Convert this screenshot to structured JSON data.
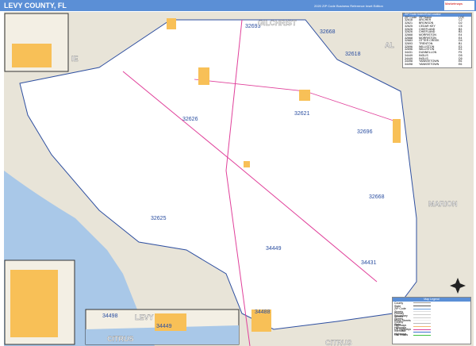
{
  "header": {
    "title": "LEVY COUNTY, FL",
    "subtitle": "2020 ZIP Code Business Reference Inset Edition",
    "logo_text": "Marketmaps"
  },
  "map": {
    "zip_labels": [
      "32693",
      "32668",
      "32618",
      "32626",
      "32621",
      "32696",
      "32668",
      "32625",
      "34449",
      "34431",
      "34498",
      "34449",
      "34488"
    ],
    "county_labels": [
      "GILCHRIST",
      "AL",
      "IE",
      "MARION",
      "LEVY",
      "CITRUS",
      "CITRUS"
    ],
    "colors": {
      "land": "#ffffff",
      "outside": "#e8e4d8",
      "water": "#a9c8e8",
      "urban": "#f8c057",
      "boundary": "#2e4fa0",
      "highway": "#e0409a"
    }
  },
  "index": {
    "title": "ZIP Code Index/Grid Locator",
    "headers": [
      "ZIP Code",
      "ZIP Name",
      "LOC"
    ],
    "rows": [
      [
        "32618",
        "ARCHER",
        "C2"
      ],
      [
        "32621",
        "BRONSON",
        "D2"
      ],
      [
        "32625",
        "CEDAR KEY",
        "C5"
      ],
      [
        "32626",
        "CHIEFLAND",
        "B3"
      ],
      [
        "32626",
        "CHIEFLAND",
        "B3"
      ],
      [
        "32668",
        "MORRISTON",
        "E4"
      ],
      [
        "32668",
        "MORRISTON",
        "E4"
      ],
      [
        "32683",
        "OTTER CREEK",
        "D4"
      ],
      [
        "32693",
        "TRENTON",
        "B1"
      ],
      [
        "32696",
        "WILLISTON",
        "E3"
      ],
      [
        "32696",
        "WILLISTON",
        "E3"
      ],
      [
        "34431",
        "DUNNELLON",
        "F5"
      ],
      [
        "34449",
        "INGLIS",
        "D5"
      ],
      [
        "34449",
        "INGLIS",
        "D5"
      ],
      [
        "34498",
        "YANKEETOWN",
        "E6"
      ],
      [
        "34498",
        "YANKEETOWN",
        "E6"
      ]
    ]
  },
  "legend": {
    "title": "Map Legend",
    "items": [
      "County",
      "State",
      "ZIP Code",
      "Streets",
      "Primary Streets",
      "Secondary Streets",
      "Minor Streets",
      "County Highways",
      "State Highways",
      "US Highways",
      "Interstate Highways",
      "Rail Roads"
    ]
  }
}
